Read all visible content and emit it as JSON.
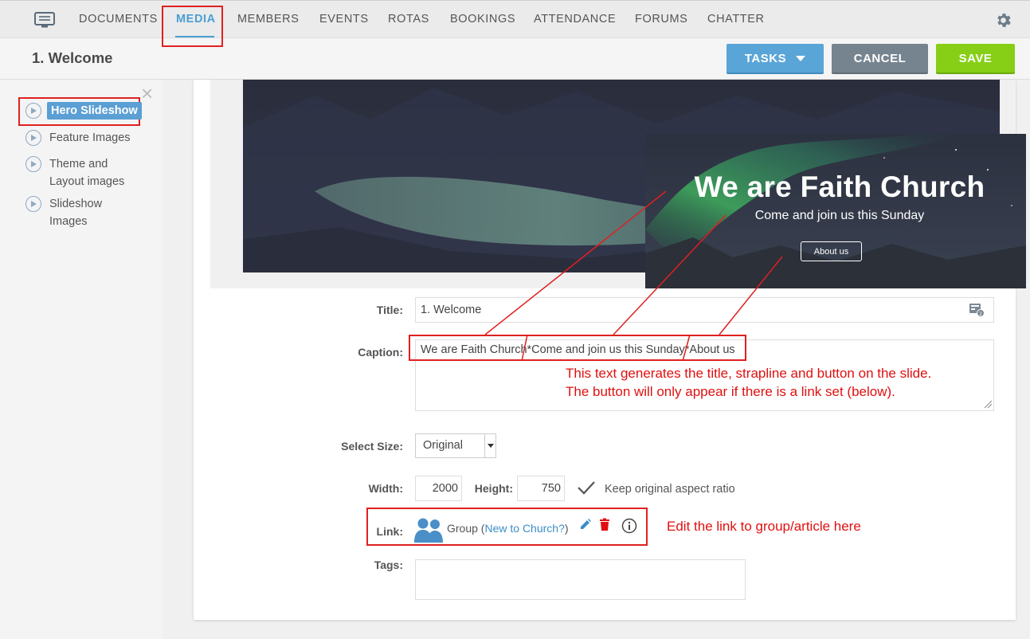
{
  "nav": {
    "items": [
      {
        "label": "DOCUMENTS",
        "active": false
      },
      {
        "label": "MEDIA",
        "active": true
      },
      {
        "label": "MEMBERS",
        "active": false
      },
      {
        "label": "EVENTS",
        "active": false
      },
      {
        "label": "ROTAS",
        "active": false
      },
      {
        "label": "BOOKINGS",
        "active": false
      },
      {
        "label": "ATTENDANCE",
        "active": false
      },
      {
        "label": "FORUMS",
        "active": false
      },
      {
        "label": "CHATTER",
        "active": false
      }
    ],
    "menu_icon": "screen-icon",
    "settings_icon": "gear-icon"
  },
  "header": {
    "title": "1. Welcome",
    "tasks_label": "TASKS",
    "cancel_label": "CANCEL",
    "save_label": "SAVE"
  },
  "sidebar": {
    "items": [
      {
        "label": "Hero Slideshow",
        "selected": true
      },
      {
        "label": "Feature Images",
        "selected": false
      },
      {
        "label": "Theme and Layout images",
        "selected": false
      },
      {
        "label": "Slideshow Images",
        "selected": false
      }
    ]
  },
  "preview": {
    "slide_title": "We are Faith Church",
    "slide_strapline": "Come and join us this Sunday",
    "slide_button": "About us"
  },
  "form": {
    "title_label": "Title:",
    "title_value": "1. Welcome",
    "caption_label": "Caption:",
    "caption_value": "We are Faith Church*Come and join us this Sunday*About us",
    "size_label": "Select Size:",
    "size_value": "Original",
    "width_label": "Width:",
    "width_value": "2000",
    "height_label": "Height:",
    "height_value": "750",
    "aspect_label": "Keep original aspect ratio",
    "link_label": "Link:",
    "link_type": "Group",
    "link_target": "New to Church?",
    "tags_label": "Tags:",
    "tags_value": ""
  },
  "annotations": {
    "caption_note_line1": "This text generates the title, strapline and button on the slide.",
    "caption_note_line2": "The button will only appear if there is a link set (below).",
    "link_note": "Edit the link to group/article here"
  },
  "colors": {
    "accent": "#4a9fd3",
    "tasks": "#5aa5d7",
    "cancel": "#76848f",
    "save": "#86cf16",
    "annotation": "#e02020"
  }
}
